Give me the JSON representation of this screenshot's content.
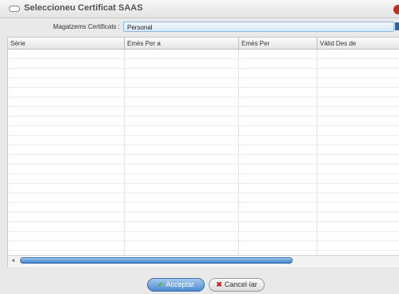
{
  "dialog": {
    "title": "Seleccioneu Certificat SAAS"
  },
  "store": {
    "label": "Magatzems Certificats :",
    "selected": "Personal"
  },
  "table": {
    "columns": [
      "Sèrie",
      "Emès Per a",
      "Emès Per",
      "Vàlid Des de"
    ],
    "rows": []
  },
  "buttons": {
    "accept": "Acceptar",
    "cancel": "Cancel·lar"
  },
  "icons": {
    "title": "window-icon",
    "close": "close-icon",
    "accept": "check-icon",
    "cancel": "x-icon"
  },
  "colors": {
    "accent": "#3f7fc6",
    "close": "#cc2a1c",
    "accept_icon": "#57b032",
    "cancel_icon": "#d0241b"
  }
}
